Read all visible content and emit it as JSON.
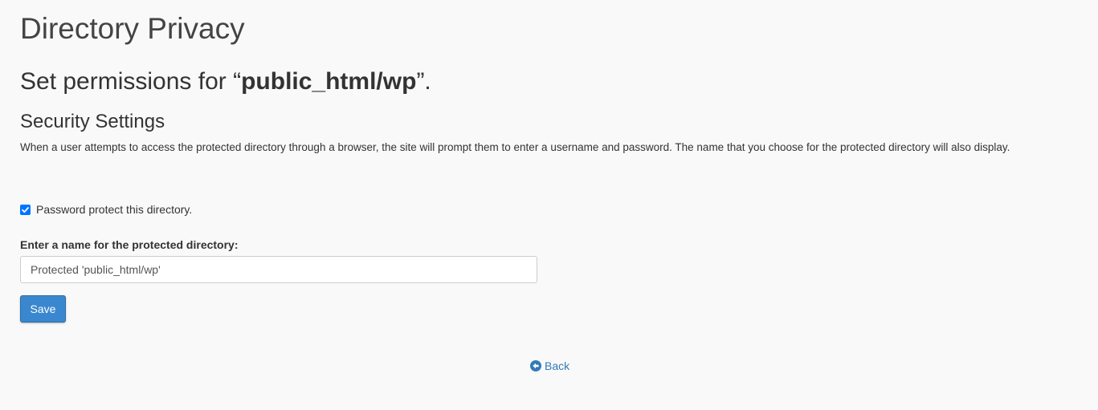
{
  "page": {
    "title": "Directory Privacy"
  },
  "permissions": {
    "prefix": "Set permissions for “",
    "directory": "public_html/wp",
    "suffix": "”."
  },
  "security": {
    "title": "Security Settings",
    "description": "When a user attempts to access the protected directory through a browser, the site will prompt them to enter a username and password. The name that you choose for the protected directory will also display."
  },
  "protect_checkbox": {
    "label": "Password protect this directory.",
    "checked": true
  },
  "name_field": {
    "label": "Enter a name for the protected directory:",
    "value": "Protected 'public_html/wp'"
  },
  "actions": {
    "save_label": "Save",
    "back_label": "Back",
    "back_icon": "arrow-circle-left-icon"
  },
  "colors": {
    "primary": "#3a87cf",
    "link": "#337ab7",
    "checkbox": "#0075ff",
    "background": "#f9f9f9"
  }
}
